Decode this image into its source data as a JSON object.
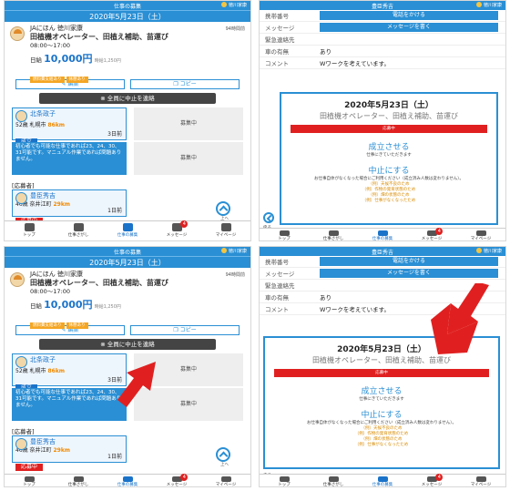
{
  "header": {
    "title": "仕事の募集",
    "user": "徳川家康"
  },
  "job": {
    "date": "2020年5月23日（土）",
    "company": "JAにほん 徳川家康",
    "title": "田植機オペレーター、田植え補助、苗運び",
    "time": "08:00～17:00",
    "wage_prefix": "日給",
    "wage": "10,000円",
    "wage_sub": "時給1,250円",
    "created": "94時間前",
    "tags": [
      "燃料費支給あり",
      "休憩あり"
    ],
    "edit": "編集",
    "copy": "コピー",
    "cancel_all": "全員に中止を連絡"
  },
  "applicants": {
    "first": {
      "name": "北条政子",
      "info": "52歳 札幌市",
      "km": "86km",
      "status": "成立",
      "ago": "3日前"
    },
    "recruit": "募集中",
    "note": "初心者でも可能な仕事であれば23、24、30、31可能です。マニュアル作業であれば問題ありません。",
    "label": "[応募者]",
    "second": {
      "name": "豊臣秀吉",
      "info": "46歳 奈井江町",
      "km": "29km",
      "status": "応募中",
      "ago": "1日前"
    },
    "up": "上へ"
  },
  "tabs": [
    "トップ",
    "仕事さがし",
    "仕事の募集",
    "メッセージ",
    "マイページ"
  ],
  "badge": "4",
  "contact": {
    "header_title": "豊臣秀吉",
    "phone_label": "携帯番号",
    "call_btn": "電話をかける",
    "msg_label": "メッセージ",
    "msg_btn": "メッセージを書く",
    "emergency_label": "緊急連絡先",
    "car_label": "車の有無",
    "car_val": "あり",
    "comment_label": "コメント",
    "comment_val": "Wワークを考えています。"
  },
  "modal": {
    "date": "2020年5月23日（土）",
    "title": "田植機オペレーター、田植え補助、苗運び",
    "red_label": "応募中",
    "confirm_big": "成立させる",
    "confirm_small": "仕事にきていただきます",
    "stop_big": "中止にする",
    "stop_small": "お仕事自体がなくなった場合にご利用ください（成立済み人数は変わりません）。",
    "reasons": [
      "（例）天候不良のため",
      "（例）作物の発育状態のため",
      "（例）畑の状態のため",
      "（例）仕事がなくなったため"
    ],
    "back": "戻る"
  },
  "colors": {
    "accent": "#2a8fd4",
    "red": "#e02020",
    "orange": "#f08a00"
  }
}
